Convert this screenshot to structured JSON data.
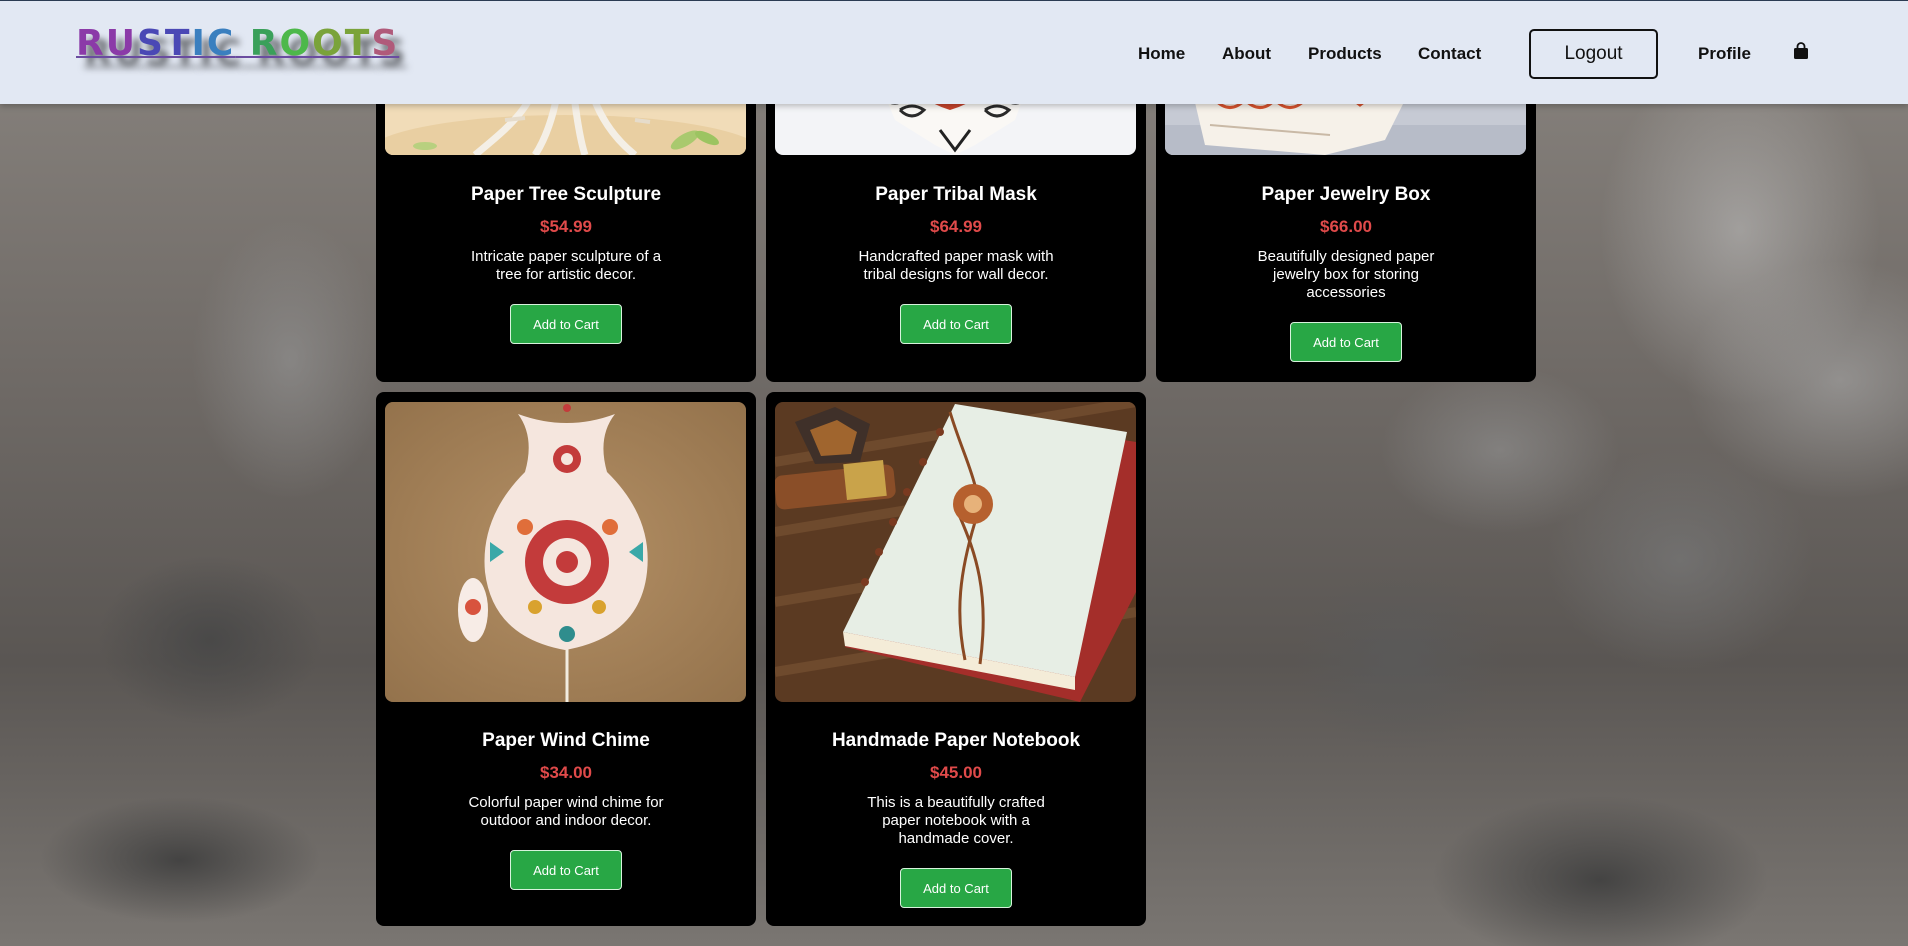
{
  "brand": {
    "letters": [
      "RU",
      "ST",
      "IC",
      " R",
      "O",
      "OT",
      "S"
    ],
    "text": "RUSTIC ROOTS"
  },
  "nav": {
    "home": "Home",
    "about": "About",
    "products": "Products",
    "contact": "Contact",
    "logout": "Logout",
    "profile": "Profile",
    "cart_icon": "shopping-bag-icon"
  },
  "products": [
    {
      "title": "Paper Tree Sculpture",
      "price": "$54.99",
      "description": "Intricate paper sculpture of a tree for artistic decor.",
      "button": "Add to Cart"
    },
    {
      "title": "Paper Tribal Mask",
      "price": "$64.99",
      "description": "Handcrafted paper mask with tribal designs for wall decor.",
      "button": "Add to Cart"
    },
    {
      "title": "Paper Jewelry Box",
      "price": "$66.00",
      "description": "Beautifully designed paper jewelry box for storing accessories",
      "button": "Add to Cart"
    },
    {
      "title": "Paper Wind Chime",
      "price": "$34.00",
      "description": "Colorful paper wind chime for outdoor and indoor decor.",
      "button": "Add to Cart"
    },
    {
      "title": "Handmade Paper Notebook",
      "price": "$45.00",
      "description": "This is a beautifully crafted paper notebook with a handmade cover.",
      "button": "Add to Cart"
    }
  ],
  "colors": {
    "navbar_bg": "#e2e8f3",
    "card_bg": "#000000",
    "price": "#e04a4a",
    "button_bg": "#28a745"
  }
}
